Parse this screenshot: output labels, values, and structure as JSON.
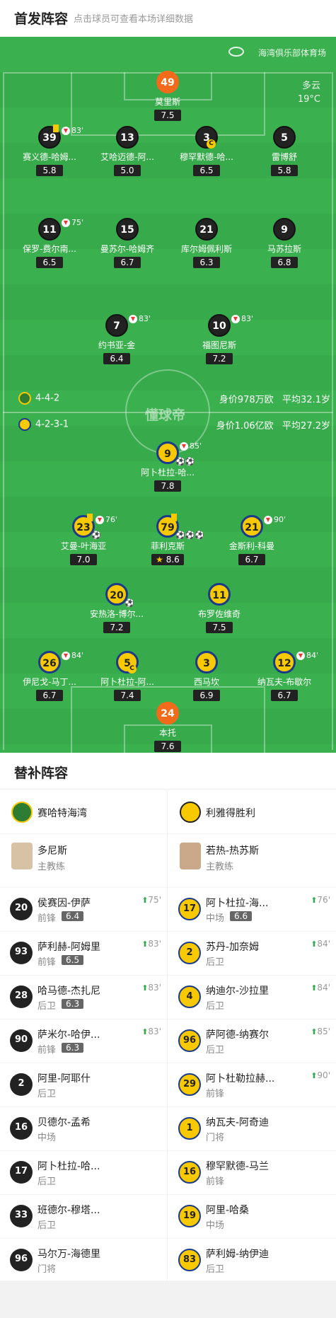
{
  "header": {
    "title": "首发阵容",
    "subtitle": "点击球员可查看本场详细数据"
  },
  "pitch": {
    "venue": "海湾俱乐部体育场",
    "weather": "多云",
    "temperature": "19°C",
    "watermark": "懂球帝",
    "home_formation": "4-4-2",
    "home_value": "身价978万欧",
    "home_age": "平均32.1岁",
    "away_formation": "4-2-3-1",
    "away_value": "身价1.06亿欧",
    "away_age": "平均27.2岁"
  },
  "home_players": [
    {
      "num": "49",
      "name": "莫里斯",
      "rating": "7.5",
      "gk": true
    },
    {
      "num": "39",
      "name": "赛义德-哈姆...",
      "rating": "5.8",
      "sub": "83'",
      "yellow": true
    },
    {
      "num": "13",
      "name": "艾哈迈德-阿...",
      "rating": "5.0"
    },
    {
      "num": "3",
      "name": "穆罕默德-哈...",
      "rating": "6.5",
      "captain": "C"
    },
    {
      "num": "5",
      "name": "雷博舒",
      "rating": "5.8"
    },
    {
      "num": "11",
      "name": "保罗-费尔南...",
      "rating": "6.5",
      "sub": "75'"
    },
    {
      "num": "15",
      "name": "曼苏尔-哈姆齐",
      "rating": "6.7"
    },
    {
      "num": "21",
      "name": "库尔姆佩利斯",
      "rating": "6.3"
    },
    {
      "num": "9",
      "name": "马苏拉斯",
      "rating": "6.8"
    },
    {
      "num": "7",
      "name": "约书亚-金",
      "rating": "6.4",
      "sub": "83'"
    },
    {
      "num": "10",
      "name": "福图尼斯",
      "rating": "7.2",
      "sub": "83'"
    }
  ],
  "away_players": [
    {
      "num": "9",
      "name": "阿卜杜拉-哈...",
      "rating": "7.8",
      "sub": "85'",
      "goals": "⚽⚽"
    },
    {
      "num": "23",
      "name": "艾曼-叶海亚",
      "rating": "7.0",
      "sub": "76'",
      "yellow": true,
      "goals": "⚽"
    },
    {
      "num": "79",
      "name": "菲利克斯",
      "rating": "8.6",
      "yellow": true,
      "goals": "⚽⚽⚽",
      "star": "★"
    },
    {
      "num": "21",
      "name": "金斯利-科曼",
      "rating": "6.7",
      "sub": "90'"
    },
    {
      "num": "20",
      "name": "安热洛-博尔...",
      "rating": "7.2",
      "goals": "⚽"
    },
    {
      "num": "11",
      "name": "布罗佐维奇",
      "rating": "7.5"
    },
    {
      "num": "26",
      "name": "伊尼戈-马丁...",
      "rating": "6.7",
      "sub": "84'"
    },
    {
      "num": "5",
      "name": "阿卜杜拉-阿...",
      "rating": "7.4",
      "captain": "C"
    },
    {
      "num": "3",
      "name": "西马坎",
      "rating": "6.9"
    },
    {
      "num": "12",
      "name": "纳瓦夫-布歇尔",
      "rating": "6.7",
      "sub": "84'"
    },
    {
      "num": "24",
      "name": "本托",
      "rating": "7.6",
      "gk": true
    }
  ],
  "subs": {
    "title": "替补阵容",
    "home": {
      "team": "赛哈特海湾",
      "coach": "多尼斯",
      "coach_role": "主教练",
      "players": [
        {
          "num": "20",
          "name": "侯赛因-伊萨",
          "pos": "前锋",
          "rating": "6.4",
          "min": "75'"
        },
        {
          "num": "93",
          "name": "萨利赫-阿姆里",
          "pos": "前锋",
          "rating": "6.5",
          "min": "83'"
        },
        {
          "num": "28",
          "name": "哈马德-杰扎尼",
          "pos": "后卫",
          "rating": "6.3",
          "min": "83'"
        },
        {
          "num": "90",
          "name": "萨米尔-哈伊...",
          "pos": "前锋",
          "rating": "6.3",
          "min": "83'"
        },
        {
          "num": "2",
          "name": "阿里-阿耶什",
          "pos": "后卫"
        },
        {
          "num": "16",
          "name": "贝德尔-孟希",
          "pos": "中场"
        },
        {
          "num": "17",
          "name": "阿卜杜拉-哈...",
          "pos": "后卫"
        },
        {
          "num": "33",
          "name": "班德尔-穆塔...",
          "pos": "后卫"
        },
        {
          "num": "96",
          "name": "马尔万-海德里",
          "pos": "门将"
        }
      ]
    },
    "away": {
      "team": "利雅得胜利",
      "coach": "若热-热苏斯",
      "coach_role": "主教练",
      "players": [
        {
          "num": "17",
          "name": "阿卜杜拉-海...",
          "pos": "中场",
          "rating": "6.6",
          "min": "76'"
        },
        {
          "num": "2",
          "name": "苏丹-加奈姆",
          "pos": "后卫",
          "min": "84'"
        },
        {
          "num": "4",
          "name": "纳迪尔-沙拉里",
          "pos": "后卫",
          "min": "84'"
        },
        {
          "num": "96",
          "name": "萨阿德-纳赛尔",
          "pos": "后卫",
          "min": "85'"
        },
        {
          "num": "29",
          "name": "阿卜杜勒拉赫...",
          "pos": "前锋",
          "min": "90'"
        },
        {
          "num": "1",
          "name": "纳瓦夫-阿奇迪",
          "pos": "门将"
        },
        {
          "num": "16",
          "name": "穆罕默德-马兰",
          "pos": "前锋"
        },
        {
          "num": "19",
          "name": "阿里-哈桑",
          "pos": "中场"
        },
        {
          "num": "83",
          "name": "萨利姆-纳伊迪",
          "pos": "后卫"
        }
      ]
    }
  },
  "colors": {
    "pitch": "#3bb04f",
    "home": "#222222",
    "away_fill": "#f9c900",
    "away_ring": "#1b3a8a",
    "gk_home": "#f26b1a"
  }
}
